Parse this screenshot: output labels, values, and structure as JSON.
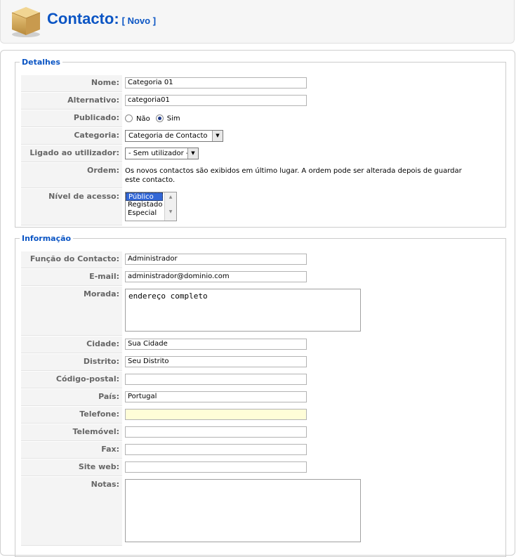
{
  "header": {
    "title": "Contacto:",
    "subtitle": "[ Novo ]"
  },
  "detalhes": {
    "legend": "Detalhes",
    "nome": {
      "label": "Nome:",
      "value": "Categoria 01"
    },
    "alternativo": {
      "label": "Alternativo:",
      "value": "categoria01"
    },
    "publicado": {
      "label": "Publicado:",
      "option_no": "Não",
      "option_yes": "Sim",
      "selected": "Sim"
    },
    "categoria": {
      "label": "Categoria:",
      "value": "Categoria de Contacto"
    },
    "ligado": {
      "label": "Ligado ao utilizador:",
      "value": "- Sem utilizador -"
    },
    "ordem": {
      "label": "Ordem:",
      "text": "Os novos contactos são exibidos em último lugar. A ordem pode ser alterada depois de guardar este contacto."
    },
    "nivel": {
      "label": "Nível de acesso:",
      "options": [
        "Público",
        "Registado",
        "Especial"
      ],
      "selected": "Público"
    }
  },
  "informacao": {
    "legend": "Informação",
    "funcao": {
      "label": "Função do Contacto:",
      "value": "Administrador"
    },
    "email": {
      "label": "E-mail:",
      "value": "administrador@dominio.com"
    },
    "morada": {
      "label": "Morada:",
      "value": "endereço completo"
    },
    "cidade": {
      "label": "Cidade:",
      "value": "Sua Cidade"
    },
    "distrito": {
      "label": "Distrito:",
      "value": "Seu Distrito"
    },
    "codigo": {
      "label": "Código-postal:",
      "value": ""
    },
    "pais": {
      "label": "País:",
      "value": "Portugal"
    },
    "telefone": {
      "label": "Telefone:",
      "value": ""
    },
    "telemovel": {
      "label": "Telemóvel:",
      "value": ""
    },
    "fax": {
      "label": "Fax:",
      "value": ""
    },
    "site": {
      "label": "Site web:",
      "value": ""
    },
    "notas": {
      "label": "Notas:",
      "value": ""
    }
  },
  "icons": {
    "header": "box-icon"
  },
  "colors": {
    "accent": "#0b55c4",
    "label_bg": "#f4f4f4",
    "highlight_input": "#fffdd8"
  }
}
